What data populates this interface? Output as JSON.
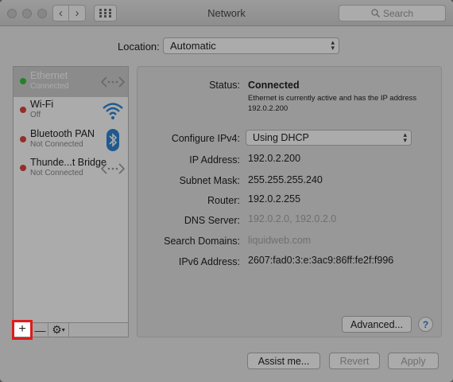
{
  "window": {
    "title": "Network"
  },
  "toolbar": {
    "back_glyph": "‹",
    "forward_glyph": "›",
    "grid_glyph": "⋮⋮⋮",
    "search_placeholder": "Search"
  },
  "location": {
    "label": "Location:",
    "value": "Automatic"
  },
  "services": [
    {
      "name": "Ethernet",
      "status": "Connected",
      "dot_color": "#35c23b",
      "icon": "ethernet-icon",
      "selected": true
    },
    {
      "name": "Wi-Fi",
      "status": "Off",
      "dot_color": "#e0443e",
      "icon": "wifi-icon",
      "selected": false
    },
    {
      "name": "Bluetooth PAN",
      "status": "Not Connected",
      "dot_color": "#e0443e",
      "icon": "bluetooth-icon",
      "selected": false
    },
    {
      "name": "Thunde...t Bridge",
      "status": "Not Connected",
      "dot_color": "#e0443e",
      "icon": "thunderbolt-bridge-icon",
      "selected": false
    }
  ],
  "sidebar_tools": {
    "add": "+",
    "remove": "—",
    "gear": "⚙"
  },
  "details": {
    "status_label": "Status:",
    "status_value": "Connected",
    "status_desc": "Ethernet is currently active and has the IP address 192.0.2.200",
    "configure_label": "Configure IPv4:",
    "configure_value": "Using DHCP",
    "ip_label": "IP Address:",
    "ip_value": "192.0.2.200",
    "subnet_label": "Subnet Mask:",
    "subnet_value": "255.255.255.240",
    "router_label": "Router:",
    "router_value": "192.0.2.255",
    "dns_label": "DNS Server:",
    "dns_value": "192.0.2.0, 192.0.2.0",
    "search_domains_label": "Search Domains:",
    "search_domains_value": "liquidweb.com",
    "ipv6_label": "IPv6 Address:",
    "ipv6_value": "2607:fad0:3:e:3ac9:86ff:fe2f:f996"
  },
  "buttons": {
    "advanced": "Advanced...",
    "help": "?",
    "assist": "Assist me...",
    "revert": "Revert",
    "apply": "Apply"
  },
  "colors": {
    "highlight": "#e01b1b",
    "connected": "#35c23b",
    "disconnected": "#e0443e",
    "link_blue": "#3b7bd8"
  }
}
